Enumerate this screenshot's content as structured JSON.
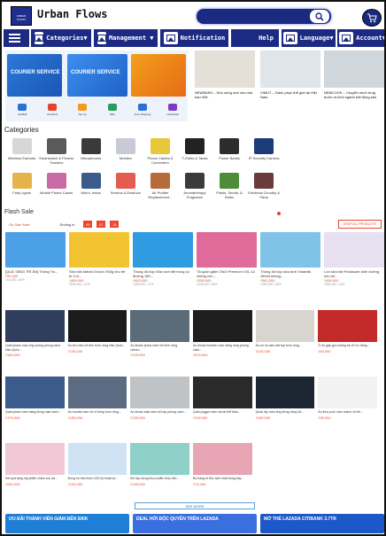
{
  "header": {
    "logo_text": "URBAN FLOWS",
    "brand": "Urban Flows",
    "search_placeholder": ""
  },
  "nav": {
    "items": [
      {
        "label": "Categories▼"
      },
      {
        "label": "Management ▼"
      },
      {
        "label": "Notification"
      },
      {
        "label": "Help"
      },
      {
        "label": "Language▼"
      },
      {
        "label": "Account▼"
      }
    ]
  },
  "banner": {
    "left_text_1": "COURIER SERVICE",
    "left_text_2": "COURIER SERVICE",
    "mini_icons": [
      {
        "label": "LazMall",
        "color": "#2d6fd8"
      },
      {
        "label": "Vouchers",
        "color": "#e0442a"
      },
      {
        "label": "Top Up",
        "color": "#f29a1a"
      },
      {
        "label": "Bills",
        "color": "#2a9d5a"
      },
      {
        "label": "Free Shipping",
        "color": "#2d6fd8"
      },
      {
        "label": "LazGlobal",
        "color": "#7b3cc4"
      }
    ],
    "news": [
      {
        "caption": "NEWBASH – Sức sống mới cho nhà bạn Việt",
        "color": "#e4e0d8"
      },
      {
        "caption": "VIMUT – Danh phục thể giới tại Việt Nam",
        "color": "#dfe5e9"
      },
      {
        "caption": "NEWLOOK – Chuyển mình từng bước ra khỏi ngành bất động sản",
        "color": "#cfd6dc"
      }
    ]
  },
  "categories": {
    "title": "Categories",
    "items": [
      {
        "label": "Wireless Earbuds",
        "color": "#d7d7d7"
      },
      {
        "label": "Smartwatch & Fitness Trackers",
        "color": "#5a5a5a"
      },
      {
        "label": "Microphones",
        "color": "#3a3a3a"
      },
      {
        "label": "Mobiles",
        "color": "#c8cbd6"
      },
      {
        "label": "Phone Cables & Converters",
        "color": "#e8c73a"
      },
      {
        "label": "T-Shirts & Tanks",
        "color": "#222222"
      },
      {
        "label": "Power Banks",
        "color": "#2c2c2c"
      },
      {
        "label": "IP Security Camera",
        "color": "#1e3b79"
      },
      {
        "label": "",
        "color": "#ffffff"
      },
      {
        "label": "",
        "color": "#ffffff"
      },
      {
        "label": "",
        "color": "#ffffff"
      },
      {
        "label": "Fairy Lights",
        "color": "#e6b34a"
      },
      {
        "label": "Mobile Phone Cases",
        "color": "#c96aa5"
      },
      {
        "label": "Men's Jeans",
        "color": "#3a5b8c"
      },
      {
        "label": "Serums & Essence",
        "color": "#e45b4f"
      },
      {
        "label": "Air Purifier Replacement...",
        "color": "#b56b3c"
      },
      {
        "label": "Aromatherapy Fragrance",
        "color": "#3b3b3b"
      },
      {
        "label": "Plants, Seeds, & Bulbs",
        "color": "#4f8c3a"
      },
      {
        "label": "Electrical Circuitry & Parts",
        "color": "#6b3b3b"
      },
      {
        "label": "",
        "color": "#ffffff"
      },
      {
        "label": "",
        "color": "#ffffff"
      },
      {
        "label": "",
        "color": "#ffffff"
      }
    ]
  },
  "flash_sale": {
    "title": "Flash Sale",
    "on_sale_now": "On Sale Now",
    "ending_in": "Ending in",
    "timer": [
      "09",
      "07",
      "18"
    ],
    "shop_all": "SHOP ALL PRODUCTS",
    "items": [
      {
        "name": "[QUÀ TẶNG TRÍ ÂN] Thông Tin...",
        "price": "₫26,400",
        "orig": "₫44,000 -40%",
        "color": "#4ba0e6"
      },
      {
        "name": "Sữa bột Abbott Grow's 900g cho trẻ từ 2-6...",
        "price": "₫469,000",
        "orig": "₫590,000 -21%",
        "color": "#f2c432"
      },
      {
        "name": "Thùng 48 hộp Sữa tươi tiệt trùng có đường 180...",
        "price": "₫400,000",
        "orig": "₫480,000 -17%",
        "color": "#2f9be0"
      },
      {
        "name": "Tã quần giảm ONO Premium XXL 42 miếng cho...",
        "price": "₫258,000",
        "orig": "₫405,000 -36%",
        "color": "#e06a9a"
      },
      {
        "name": "Thùng 48 hộp sữa tươi Vinamilk 180ml không...",
        "price": "₫360,000",
        "orig": "₫480,000 -25%",
        "color": "#7fc4e8"
      },
      {
        "name": "Lon sữa bột Pediasure dinh dưỡng cho trẻ...",
        "price": "₫455,000",
        "orig": "₫560,000 -19%",
        "color": "#e6e0f0"
      }
    ]
  },
  "products": [
    {
      "title": "Quần jeans nam ống suông phong cách Hàn Quốc...",
      "price": "₫169,000",
      "color": "#2e3e5c"
    },
    {
      "title": "Áo len nam cổ tròn form rộng Hàn Quốc...",
      "price": "₫139,000",
      "color": "#1b1b1b"
    },
    {
      "title": "Áo khoác jeans nam nữ form rộng unisex...",
      "price": "₫199,000",
      "color": "#5a6b7a"
    },
    {
      "title": "Áo khoác bomber nam dáng rộng phong cách...",
      "price": "₫229,000",
      "color": "#1e1e1e"
    },
    {
      "title": "Áo sơ mi nam dài tay form rộng...",
      "price": "₫149,000",
      "color": "#d8d4ce"
    },
    {
      "title": "Ô dù gấp gọn chống tia UV tự động...",
      "price": "₫89,000",
      "color": "#c42a2a"
    },
    {
      "title": "Quần jeans nam dáng đứng màu xanh...",
      "price": "₫179,000",
      "color": "#3a5b8c"
    },
    {
      "title": "Áo hoodie nam nữ nỉ bông form rộng...",
      "price": "₫159,000",
      "color": "#5b6c82"
    },
    {
      "title": "Áo khoác kaki nam túi hộp phong cách...",
      "price": "₫239,000",
      "color": "#bfc3c6"
    },
    {
      "title": "Quần jogger nam vải dù thể thao...",
      "price": "₫119,000",
      "color": "#2a2a2a"
    },
    {
      "title": "Quần tây nam ống đứng công sở...",
      "price": "₫189,000",
      "color": "#1c2733"
    },
    {
      "title": "Áo thun polo nam cotton cổ bẻ...",
      "price": "₫99,000",
      "color": "#f2f2f2"
    },
    {
      "title": "Set quà tặng mỹ phẩm chăm sóc da...",
      "price": "₫259,000",
      "color": "#f1c9d6"
    },
    {
      "title": "Đồng hồ báo thức LED kỹ thuật số...",
      "price": "₫129,000",
      "color": "#cfe3f5"
    },
    {
      "title": "Bộ hộp đựng thực phẩm thủy tinh...",
      "price": "₫199,000",
      "color": "#8fd0c8"
    },
    {
      "title": "Bộ trang trí tiệc sinh nhật bóng bay...",
      "price": "₫79,000",
      "color": "#e8a6b5"
    },
    {
      "title": "",
      "price": "",
      "color": "#ffffff"
    },
    {
      "title": "",
      "price": "",
      "color": "#ffffff"
    }
  ],
  "see_more": "SEE MORE",
  "footer_banners": [
    {
      "text": "ƯU ĐÃI THÀNH VIÊN GIẢM ĐẾN 500K",
      "color": "#1f7fd6"
    },
    {
      "text": "DEAL HỜI ĐỘC QUYỀN TRÊN LAZADA",
      "color": "#3a6fe0"
    },
    {
      "text": "MỞ THẺ LAZADA CITIBANK 3.7TR",
      "color": "#1d58c9"
    }
  ]
}
